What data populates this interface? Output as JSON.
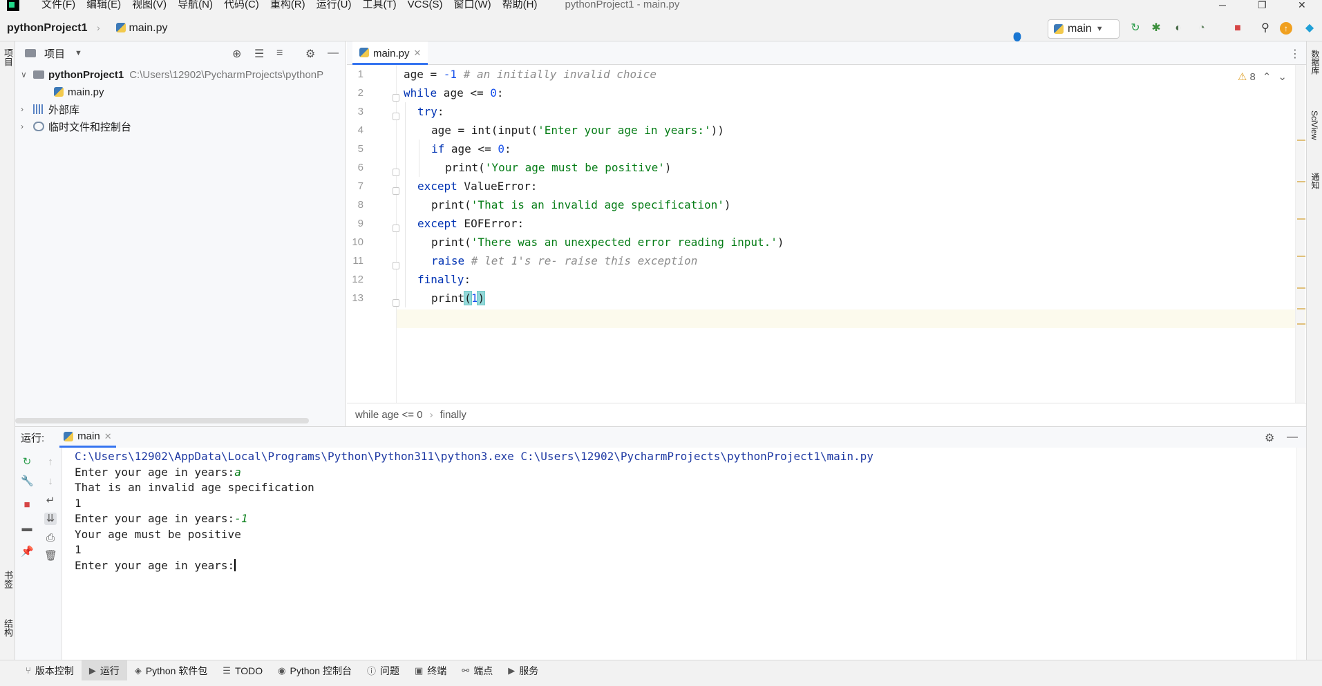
{
  "menubar": {
    "items": [
      "文件(F)",
      "编辑(E)",
      "视图(V)",
      "导航(N)",
      "代码(C)",
      "重构(R)",
      "运行(U)",
      "工具(T)",
      "VCS(S)",
      "窗口(W)",
      "帮助(H)"
    ],
    "window_title": "pythonProject1 - main.py"
  },
  "toolbar": {
    "project_name": "pythonProject1",
    "current_file": "main.py",
    "run_config": "main"
  },
  "left_strip": {
    "project_label": "项目",
    "bookmarks_label": "书签",
    "structure_label": "结构"
  },
  "right_strip": {
    "database_label": "数据库",
    "sciview_label": "SciView",
    "notifications_label": "通知"
  },
  "project_panel": {
    "title": "项目",
    "root": {
      "name": "pythonProject1",
      "path": "C:\\Users\\12902\\PycharmProjects\\pythonP"
    },
    "file": "main.py",
    "external_libs": "外部库",
    "scratches": "临时文件和控制台"
  },
  "editor": {
    "tab_label": "main.py",
    "warning_count": "8",
    "line_numbers": [
      "1",
      "2",
      "3",
      "4",
      "5",
      "6",
      "7",
      "8",
      "9",
      "10",
      "11",
      "12",
      "13"
    ],
    "code": {
      "l1_a": "age = ",
      "l1_num": "-1",
      "l1_cm": " # an initially invalid choice",
      "l2_kw": "while",
      "l2_a": " age <= ",
      "l2_num": "0",
      "l2_b": ":",
      "l3_kw": "try",
      "l3_b": ":",
      "l4_a": "age = int(input(",
      "l4_str": "'Enter your age in years:'",
      "l4_b": "))",
      "l5_kw": "if",
      "l5_a": " age <= ",
      "l5_num": "0",
      "l5_b": ":",
      "l6_a": "print(",
      "l6_str": "'Your age must be positive'",
      "l6_b": ")",
      "l7_kw": "except",
      "l7_a": " ValueError:",
      "l8_a": "print(",
      "l8_str": "'That is an invalid age specification'",
      "l8_b": ")",
      "l9_kw": "except",
      "l9_a": " EOFError:",
      "l10_a": "print(",
      "l10_str": "'There was an unexpected error reading input.'",
      "l10_b": ")",
      "l11_kw": "raise",
      "l11_cm": " # let 1's re- raise this exception",
      "l12_kw": "finally",
      "l12_b": ":",
      "l13_a": "print",
      "l13_open": "(",
      "l13_num": "1",
      "l13_close": ")"
    },
    "breadcrumb": [
      "while age <= 0",
      "finally"
    ]
  },
  "run_panel": {
    "label": "运行:",
    "tab": "main",
    "console": {
      "cmd": "C:\\Users\\12902\\AppData\\Local\\Programs\\Python\\Python311\\python3.exe C:\\Users\\12902\\PycharmProjects\\pythonProject1\\main.py",
      "prompt1": "Enter your age in years:",
      "input1": "a",
      "out1": "That is an invalid age specification",
      "out2": "1",
      "prompt2": "Enter your age in years:",
      "input2": "-1",
      "out3": "Your age must be positive",
      "out4": "1",
      "prompt3": "Enter your age in years:"
    }
  },
  "bottom_tabs": [
    "版本控制",
    "运行",
    "Python 软件包",
    "TODO",
    "Python 控制台",
    "问题",
    "终端",
    "端点",
    "服务"
  ],
  "colors": {
    "accent": "#3574f0",
    "keyword": "#0033b3",
    "string": "#067d17",
    "number": "#1750eb",
    "comment": "#8c8c8c"
  }
}
